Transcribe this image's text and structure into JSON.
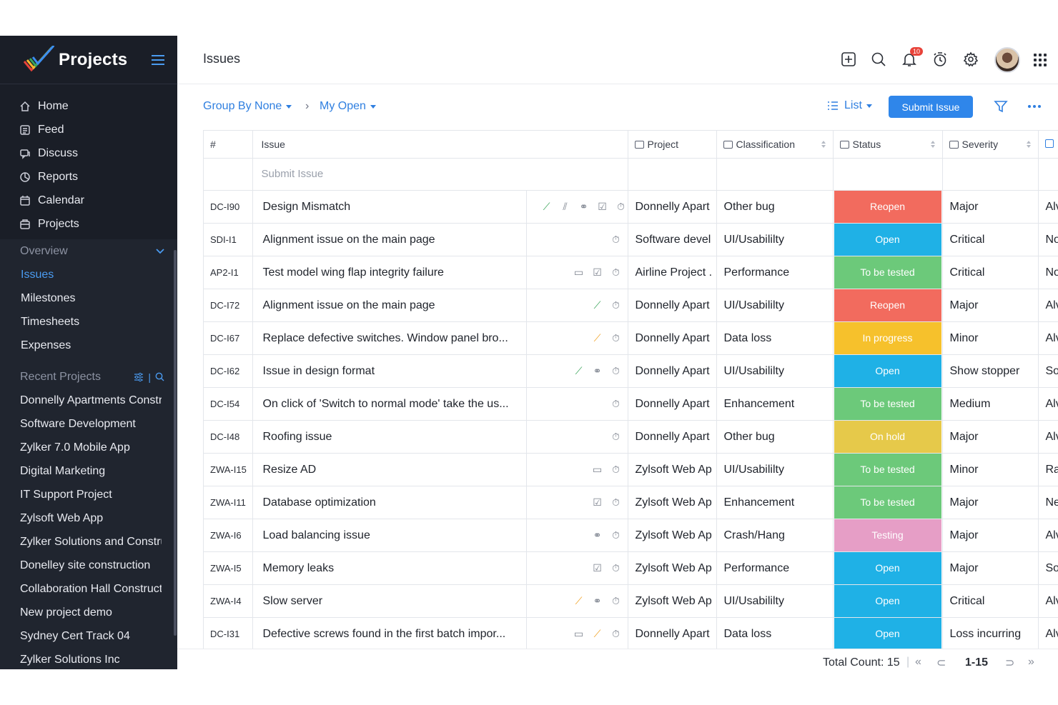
{
  "app": {
    "brand": "Projects"
  },
  "sidebar": {
    "nav": [
      {
        "label": "Home",
        "icon": "home-icon"
      },
      {
        "label": "Feed",
        "icon": "feed-icon"
      },
      {
        "label": "Discuss",
        "icon": "discuss-icon"
      },
      {
        "label": "Reports",
        "icon": "reports-icon"
      },
      {
        "label": "Calendar",
        "icon": "calendar-icon"
      },
      {
        "label": "Projects",
        "icon": "projects-icon"
      }
    ],
    "overview": {
      "label": "Overview",
      "items": [
        {
          "label": "Issues",
          "active": true
        },
        {
          "label": "Milestones"
        },
        {
          "label": "Timesheets"
        },
        {
          "label": "Expenses"
        }
      ]
    },
    "recent": {
      "label": "Recent Projects",
      "items": [
        "Donnelly Apartments Construction",
        "Software Development",
        "Zylker 7.0 Mobile App",
        "Digital Marketing",
        "IT Support Project",
        "Zylsoft Web App",
        "Zylker Solutions and Construction",
        "Donelley site construction",
        "Collaboration Hall Construction",
        "New project demo",
        "Sydney Cert Track 04",
        "Zylker Solutions Inc"
      ]
    }
  },
  "header": {
    "title": "Issues",
    "notification_count": "10"
  },
  "toolbar": {
    "group_by": "Group By None",
    "breadcrumb_sep": "›",
    "filter_view": "My Open",
    "view_mode": "List",
    "submit_label": "Submit Issue"
  },
  "table": {
    "columns": {
      "id": "#",
      "issue": "Issue",
      "project": "Project",
      "classification": "Classification",
      "status": "Status",
      "severity": "Severity"
    },
    "placeholder": "Submit Issue",
    "rows": [
      {
        "id": "DC-I90",
        "issue": "Design Mismatch",
        "icons": [
          "link-green",
          "attach",
          "link",
          "checklist",
          "timer"
        ],
        "project": "Donnelly Apart",
        "classification": "Other bug",
        "status": "Reopen",
        "severity": "Major",
        "extra": "Alv"
      },
      {
        "id": "SDI-I1",
        "issue": "Alignment issue on the main page",
        "icons": [
          "timer"
        ],
        "project": "Software devel",
        "classification": "UI/Usabililty",
        "status": "Open",
        "severity": "Critical",
        "extra": "No"
      },
      {
        "id": "AP2-I1",
        "issue": "Test model wing flap integrity failure",
        "icons": [
          "comment",
          "checklist",
          "timer"
        ],
        "project": "Airline Project .",
        "classification": "Performance",
        "status": "To be tested",
        "severity": "Critical",
        "extra": "No"
      },
      {
        "id": "DC-I72",
        "issue": "Alignment issue on the main page",
        "icons": [
          "link-green",
          "timer"
        ],
        "project": "Donnelly Apart",
        "classification": "UI/Usabililty",
        "status": "Reopen",
        "severity": "Major",
        "extra": "Alv"
      },
      {
        "id": "DC-I67",
        "issue": "Replace defective switches. Window panel bro...",
        "icons": [
          "link-orange",
          "timer"
        ],
        "project": "Donnelly Apart",
        "classification": "Data loss",
        "status": "In progress",
        "severity": "Minor",
        "extra": "Alv"
      },
      {
        "id": "DC-I62",
        "issue": "Issue in design format",
        "icons": [
          "link-green",
          "link",
          "timer"
        ],
        "project": "Donnelly Apart",
        "classification": "UI/Usabililty",
        "status": "Open",
        "severity": "Show stopper",
        "extra": "So"
      },
      {
        "id": "DC-I54",
        "issue": "On click of 'Switch to normal mode' take the us...",
        "icons": [
          "timer"
        ],
        "project": "Donnelly Apart",
        "classification": "Enhancement",
        "status": "To be tested",
        "severity": "Medium",
        "extra": "Alv"
      },
      {
        "id": "DC-I48",
        "issue": "Roofing issue",
        "icons": [
          "timer"
        ],
        "project": "Donnelly Apart",
        "classification": "Other bug",
        "status": "On hold",
        "severity": "Major",
        "extra": "Alv"
      },
      {
        "id": "ZWA-I15",
        "issue": "Resize AD",
        "icons": [
          "comment",
          "timer"
        ],
        "project": "Zylsoft Web Ap",
        "classification": "UI/Usabililty",
        "status": "To be tested",
        "severity": "Minor",
        "extra": "Ra"
      },
      {
        "id": "ZWA-I11",
        "issue": "Database optimization",
        "icons": [
          "checklist",
          "timer"
        ],
        "project": "Zylsoft Web Ap",
        "classification": "Enhancement",
        "status": "To be tested",
        "severity": "Major",
        "extra": "Ne"
      },
      {
        "id": "ZWA-I6",
        "issue": "Load balancing issue",
        "icons": [
          "link",
          "timer"
        ],
        "project": "Zylsoft Web Ap",
        "classification": "Crash/Hang",
        "status": "Testing",
        "severity": "Major",
        "extra": "Alv"
      },
      {
        "id": "ZWA-I5",
        "issue": "Memory leaks",
        "icons": [
          "checklist",
          "timer"
        ],
        "project": "Zylsoft Web Ap",
        "classification": "Performance",
        "status": "Open",
        "severity": "Major",
        "extra": "So"
      },
      {
        "id": "ZWA-I4",
        "issue": "Slow server",
        "icons": [
          "link-orange",
          "link",
          "timer"
        ],
        "project": "Zylsoft Web Ap",
        "classification": "UI/Usabililty",
        "status": "Open",
        "severity": "Critical",
        "extra": "Alv"
      },
      {
        "id": "DC-I31",
        "issue": "Defective screws found in the first batch impor...",
        "icons": [
          "comment",
          "link-orange",
          "timer"
        ],
        "project": "Donnelly Apart",
        "classification": "Data loss",
        "status": "Open",
        "severity": "Loss incurring",
        "extra": "Alv"
      }
    ]
  },
  "status_colors": {
    "Reopen": "#f26b5e",
    "Open": "#1fb1e6",
    "To be tested": "#6cc97a",
    "In progress": "#f6c12c",
    "On hold": "#e6c94a",
    "Testing": "#e69ec6"
  },
  "footer": {
    "total": "Total Count: 15",
    "range": "1-15"
  }
}
